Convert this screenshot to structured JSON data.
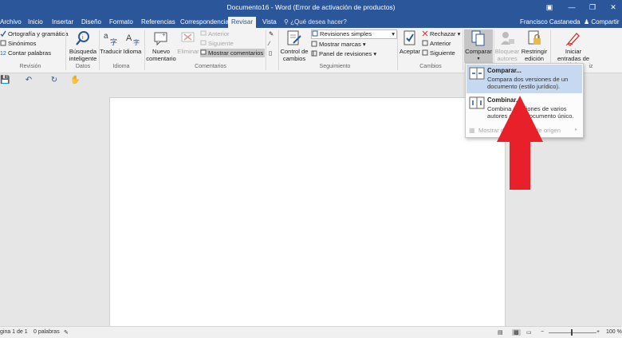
{
  "window": {
    "title": "Documento16 - Word (Error de activación de productos)",
    "user": "Francisco Castaneda",
    "share_label": "Compartir"
  },
  "tabs": [
    {
      "label": "Archivo"
    },
    {
      "label": "Inicio"
    },
    {
      "label": "Insertar"
    },
    {
      "label": "Diseño"
    },
    {
      "label": "Formato"
    },
    {
      "label": "Referencias"
    },
    {
      "label": "Correspondencia"
    },
    {
      "label": "Revisar"
    },
    {
      "label": "Vista"
    }
  ],
  "tell_me": "¿Qué desea hacer?",
  "ribbon": {
    "revision": {
      "label": "Revisión",
      "items": [
        "Ortografía y gramática",
        "Sinónimos",
        "Contar palabras"
      ]
    },
    "datos": {
      "label": "Datos",
      "smart_lookup": "Búsqueda inteligente"
    },
    "idioma": {
      "label": "Idioma",
      "translate": "Traducir",
      "language": "Idioma"
    },
    "comentarios": {
      "label": "Comentarios",
      "new_comment": "Nuevo comentario",
      "delete": "Eliminar",
      "previous": "Anterior",
      "next": "Siguiente",
      "show_comments": "Mostrar comentarios"
    },
    "seguimiento": {
      "label": "Seguimiento",
      "track_changes": "Control de cambios",
      "markup_view": "Revisiones simples",
      "show_markup": "Mostrar marcas",
      "reviewing_pane": "Panel de revisiones"
    },
    "cambios": {
      "label": "Cambios",
      "accept": "Aceptar",
      "reject": "Rechazar",
      "previous": "Anterior",
      "next": "Siguiente"
    },
    "comparar": {
      "label": "Comparar"
    },
    "proteger": {
      "block_authors": "Bloquear autores",
      "restrict_editing": "Restringir edición"
    },
    "entrada_lapiz": {
      "start_inking": "Iniciar entradas de lápiz",
      "label_fragment": "iz"
    }
  },
  "compare_menu": {
    "items": [
      {
        "title": "Comparar...",
        "description": "Compara dos versiones de un documento (estilo jurídico)."
      },
      {
        "title": "Combinar...",
        "description": "Combina revisiones de varios autores en un documento único."
      }
    ],
    "disabled_item": "Mostrar documentos de origen"
  },
  "status_bar": {
    "page": "gina 1 de 1",
    "words": "0 palabras",
    "zoom": "100 %"
  },
  "colors": {
    "accent": "#2b579a",
    "arrow": "#e8202a",
    "highlight": "#c6d9f1"
  }
}
